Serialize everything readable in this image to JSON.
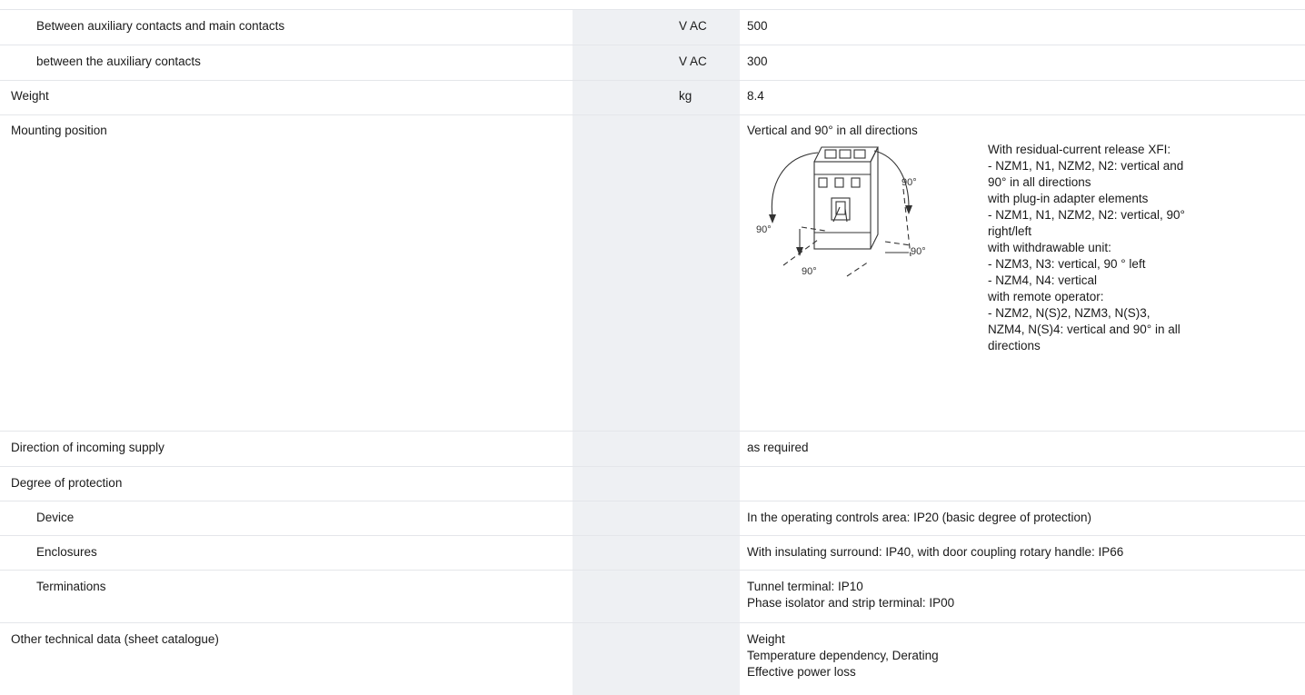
{
  "rows": {
    "aux_main": {
      "label": "Between auxiliary contacts and main contacts",
      "unit": "V AC",
      "value": "500"
    },
    "aux_aux": {
      "label": "between the auxiliary contacts",
      "unit": "V AC",
      "value": "300"
    },
    "weight": {
      "label": "Weight",
      "unit": "kg",
      "value": "8.4"
    },
    "mounting": {
      "label": "Mounting position",
      "value": "Vertical and 90° in all directions",
      "diagram_labels": [
        "90°",
        "90°",
        "90°",
        "90°"
      ],
      "notes": [
        "With residual-current release XFI:",
        "- NZM1, N1, NZM2, N2: vertical and",
        "90° in all directions",
        "with plug-in adapter elements",
        "- NZM1, N1, NZM2, N2: vertical, 90°",
        "right/left",
        "with withdrawable unit:",
        "- NZM3, N3: vertical, 90 ° left",
        "- NZM4, N4: vertical",
        "with remote operator:",
        "- NZM2, N(S)2, NZM3, N(S)3,",
        "NZM4, N(S)4: vertical and 90° in all",
        "directions"
      ]
    },
    "incoming": {
      "label": "Direction of incoming supply",
      "value": "as required"
    },
    "protection": {
      "label": "Degree of protection"
    },
    "device": {
      "label": "Device",
      "value": "In the operating controls area: IP20 (basic degree of protection)"
    },
    "enclosures": {
      "label": "Enclosures",
      "value": "With insulating surround: IP40, with door coupling rotary handle: IP66"
    },
    "terminations": {
      "label": "Terminations",
      "value_lines": [
        "Tunnel terminal: IP10",
        "Phase isolator and strip terminal: IP00"
      ]
    },
    "other": {
      "label": "Other technical data (sheet catalogue)",
      "value_lines": [
        "Weight",
        "Temperature dependency, Derating",
        "Effective power loss"
      ]
    }
  }
}
